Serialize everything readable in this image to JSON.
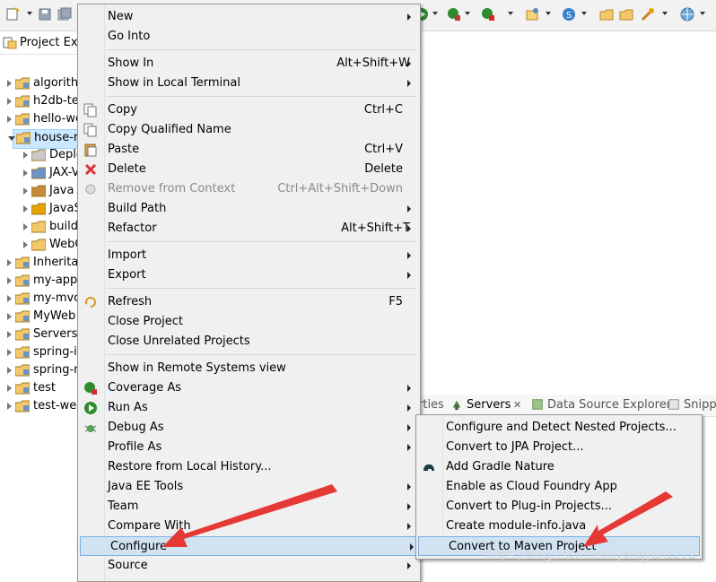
{
  "explorer": {
    "tab_label": "Project Exp",
    "items": [
      {
        "label": "algorith",
        "open": false
      },
      {
        "label": "h2db-te",
        "open": false
      },
      {
        "label": "hello-wo",
        "open": false
      },
      {
        "label": "house-r",
        "open": true,
        "selected": true
      },
      {
        "label": "Deplo",
        "child": true
      },
      {
        "label": "JAX-V",
        "child": true
      },
      {
        "label": "Java",
        "child": true
      },
      {
        "label": "JavaS",
        "child": true
      },
      {
        "label": "build",
        "child": true
      },
      {
        "label": "WebC",
        "child": true
      },
      {
        "label": "Inherita",
        "open": false
      },
      {
        "label": "my-app",
        "open": false
      },
      {
        "label": "my-mvc",
        "open": false
      },
      {
        "label": "MyWeb",
        "open": false
      },
      {
        "label": "Servers",
        "open": false
      },
      {
        "label": "spring-i",
        "open": false
      },
      {
        "label": "spring-r",
        "open": false
      },
      {
        "label": "test",
        "open": false
      },
      {
        "label": "test-wel",
        "open": false
      }
    ]
  },
  "bottom_tabs": {
    "properties_tail": "rties",
    "servers": "Servers",
    "servers_close": "✕",
    "data_source": "Data Source Explorer",
    "snippets": "Snipp"
  },
  "context_menu": {
    "items": [
      {
        "label": "New",
        "shortcut": "",
        "submenu": true
      },
      {
        "label": "Go Into",
        "shortcut": "",
        "submenu": false
      },
      {
        "label": "Show In",
        "shortcut": "Alt+Shift+W",
        "submenu": true
      },
      {
        "label": "Show in Local Terminal",
        "shortcut": "",
        "submenu": true
      },
      {
        "label": "Copy",
        "shortcut": "Ctrl+C",
        "submenu": false
      },
      {
        "label": "Copy Qualified Name",
        "shortcut": "",
        "submenu": false
      },
      {
        "label": "Paste",
        "shortcut": "Ctrl+V",
        "submenu": false
      },
      {
        "label": "Delete",
        "shortcut": "Delete",
        "submenu": false
      },
      {
        "label": "Remove from Context",
        "shortcut": "Ctrl+Alt+Shift+Down",
        "submenu": false,
        "disabled": true
      },
      {
        "label": "Build Path",
        "shortcut": "",
        "submenu": true
      },
      {
        "label": "Refactor",
        "shortcut": "Alt+Shift+T",
        "submenu": true
      },
      {
        "label": "Import",
        "shortcut": "",
        "submenu": true
      },
      {
        "label": "Export",
        "shortcut": "",
        "submenu": true
      },
      {
        "label": "Refresh",
        "shortcut": "F5",
        "submenu": false
      },
      {
        "label": "Close Project",
        "shortcut": "",
        "submenu": false
      },
      {
        "label": "Close Unrelated Projects",
        "shortcut": "",
        "submenu": false
      },
      {
        "label": "Show in Remote Systems view",
        "shortcut": "",
        "submenu": false
      },
      {
        "label": "Coverage As",
        "shortcut": "",
        "submenu": true
      },
      {
        "label": "Run As",
        "shortcut": "",
        "submenu": true
      },
      {
        "label": "Debug As",
        "shortcut": "",
        "submenu": true
      },
      {
        "label": "Profile As",
        "shortcut": "",
        "submenu": true
      },
      {
        "label": "Restore from Local History...",
        "shortcut": "",
        "submenu": false
      },
      {
        "label": "Java EE Tools",
        "shortcut": "",
        "submenu": true
      },
      {
        "label": "Team",
        "shortcut": "",
        "submenu": true
      },
      {
        "label": "Compare With",
        "shortcut": "",
        "submenu": true
      },
      {
        "label": "Configure",
        "shortcut": "",
        "submenu": true,
        "highlighted": true
      },
      {
        "label": "Source",
        "shortcut": "",
        "submenu": true
      }
    ]
  },
  "configure_submenu": {
    "items": [
      {
        "label": "Configure and Detect Nested Projects..."
      },
      {
        "label": "Convert to JPA Project..."
      },
      {
        "label": "Add Gradle Nature"
      },
      {
        "label": "Enable as Cloud Foundry App"
      },
      {
        "label": "Convert to Plug-in Projects..."
      },
      {
        "label": "Create module-info.java"
      },
      {
        "label": "Convert to Maven Project",
        "highlighted": true
      }
    ]
  },
  "watermark": "https://blog.csdn.net/liyongyan1212",
  "colors": {
    "highlight_fill": "#d1e2f2",
    "highlight_border": "#78aee5",
    "annotation_arrow": "#e53935"
  }
}
